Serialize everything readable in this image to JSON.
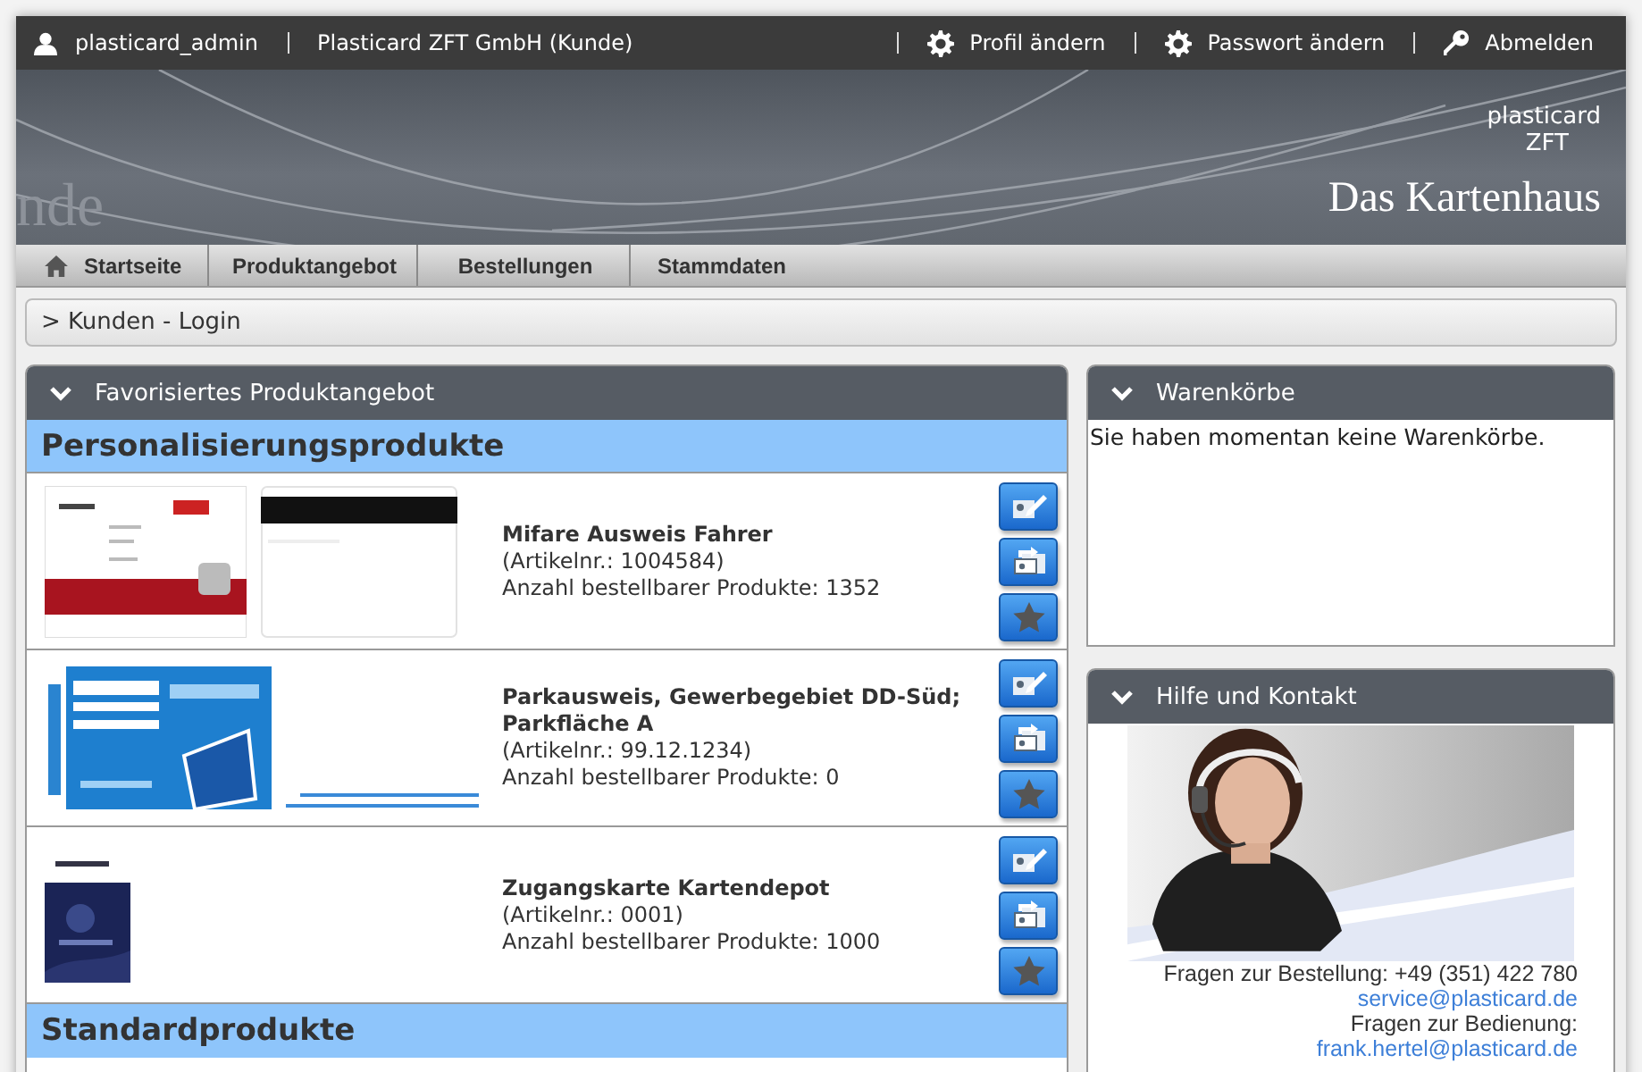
{
  "user_bar": {
    "username": "plasticard_admin",
    "company": "Plasticard ZFT GmbH (Kunde)",
    "links": [
      {
        "label": "Profil ändern"
      },
      {
        "label": "Passwort ändern"
      },
      {
        "label": "Abmelden"
      }
    ]
  },
  "banner": {
    "backdrop_text": "nde",
    "logo_top": "plasticard",
    "logo_bottom": "ZFT",
    "tagline": "Das Kartenhaus"
  },
  "nav": [
    {
      "label": "Startseite"
    },
    {
      "label": "Produktangebot"
    },
    {
      "label": "Bestellungen"
    },
    {
      "label": "Stammdaten"
    }
  ],
  "breadcrumb": "> Kunden - Login",
  "favorites": {
    "title": "Favorisiertes Produktangebot",
    "expanded": true,
    "sections": [
      {
        "title": "Personalisierungsprodukte",
        "products": [
          {
            "name": "Mifare Ausweis Fahrer",
            "article": "(Artikelnr.: 1004584)",
            "count": "Anzahl bestellbarer Produkte: 1352"
          },
          {
            "name": "Parkausweis, Gewerbegebiet DD-Süd; Parkfläche A",
            "article": "(Artikelnr.: 99.12.1234)",
            "count": "Anzahl bestellbarer Produkte: 0"
          },
          {
            "name": "Zugangskarte Kartendepot",
            "article": "(Artikelnr.: 0001)",
            "count": "Anzahl bestellbarer Produkte: 1000"
          }
        ]
      },
      {
        "title": "Standardprodukte"
      }
    ]
  },
  "carts": {
    "title": "Warenkörbe",
    "expanded": true,
    "message": "Sie haben momentan keine Warenkörbe."
  },
  "help": {
    "title": "Hilfe und Kontakt",
    "expanded": true,
    "lines": [
      {
        "kind": "text",
        "text": "Fragen zur Bestellung: +49 (351) 422 780"
      },
      {
        "kind": "link",
        "text": "service@plasticard.de"
      },
      {
        "kind": "text",
        "text": "Fragen zur Bedienung:"
      },
      {
        "kind": "link",
        "text": "frank.hertel@plasticard.de"
      }
    ]
  }
}
